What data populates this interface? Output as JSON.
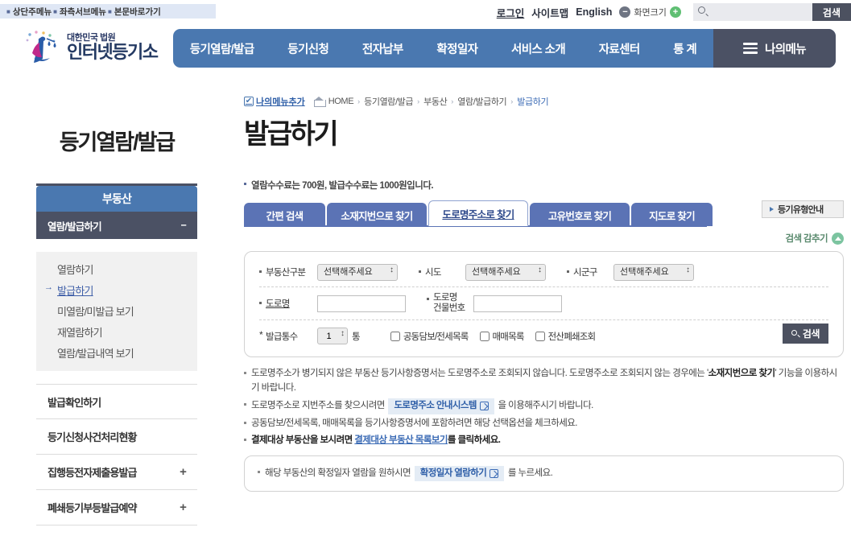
{
  "skipnav": {
    "items": [
      "상단주메뉴",
      "좌측서브메뉴",
      "본문바로가기"
    ]
  },
  "utility": {
    "login": "로그인",
    "sitemap": "사이트맵",
    "english": "English",
    "zoom_label": "화면크기",
    "zoom_out": "−",
    "zoom_in": "+",
    "search_placeholder": "",
    "search_value": "",
    "search_button": "검색"
  },
  "logo": {
    "line1": "대한민국 법원",
    "line2": "인터넷등기소"
  },
  "gnb": {
    "items": [
      "등기열람/발급",
      "등기신청",
      "전자납부",
      "확정일자",
      "서비스 소개",
      "자료센터",
      "통 계"
    ],
    "mymenu": "나의메뉴"
  },
  "breadcrumb": {
    "add_label": "나의메뉴추가",
    "check_glyph": "✔",
    "home": "HOME",
    "arrow": "›",
    "segments": [
      "등기열람/발급",
      "부동산",
      "열람/발급하기"
    ],
    "current": "발급하기"
  },
  "sidebar": {
    "title": "등기열람/발급",
    "category": "부동산",
    "group": {
      "label": "열람/발급하기",
      "toggle": "−"
    },
    "sub_items": [
      {
        "label": "열람하기",
        "active": false
      },
      {
        "label": "발급하기",
        "active": true
      },
      {
        "label": "미열람/미발급 보기",
        "active": false
      },
      {
        "label": "재열람하기",
        "active": false
      },
      {
        "label": "열람/발급내역 보기",
        "active": false
      }
    ],
    "rows": [
      {
        "label": "발급확인하기",
        "toggle": ""
      },
      {
        "label": "등기신청사건처리현황",
        "toggle": ""
      },
      {
        "label": "집행등전자제출용발급",
        "toggle": "+"
      },
      {
        "label": "폐쇄등기부등발급예약",
        "toggle": "+"
      }
    ]
  },
  "main": {
    "page_title": "발급하기",
    "fee_note": "열람수수료는 700원, 발급수수료는 1000원입니다.",
    "tabs": [
      {
        "label": "간편 검색",
        "active": false
      },
      {
        "label": "소재지번으로 찾기",
        "active": false
      },
      {
        "label": "도로명주소로 찾기",
        "active": true
      },
      {
        "label": "고유번호로 찾기",
        "active": false
      },
      {
        "label": "지도로 찾기",
        "active": false
      }
    ],
    "guide_button": "등기유형안내",
    "hide_search": "검색 감추기"
  },
  "form": {
    "property_type": {
      "label": "부동산구분",
      "value": "선택해주세요"
    },
    "sido": {
      "label": "시도",
      "value": "선택해주세요"
    },
    "sigungu": {
      "label": "시군구",
      "value": "선택해주세요"
    },
    "road_name": {
      "label": "도로명",
      "value": ""
    },
    "building_no": {
      "label_line1": "도로명",
      "label_line2": "건물번호",
      "value": ""
    },
    "copies": {
      "label": "발급통수",
      "value": "1",
      "unit": "통"
    },
    "checkboxes": [
      {
        "label": "공동담보/전세목록",
        "checked": false
      },
      {
        "label": "매매목록",
        "checked": false
      },
      {
        "label": "전산폐쇄조회",
        "checked": false
      }
    ],
    "search_button": "검색"
  },
  "notices": [
    {
      "parts": [
        {
          "t": "도로명주소가 병기되지 않은 부동산 등기사항증명서는 도로명주소로 조회되지 않습니다. 도로명주소로 조회되지 않는 경우에는 '",
          "k": "text"
        },
        {
          "t": "소재지번으로 찾기",
          "k": "bold"
        },
        {
          "t": "' 기능을 이용하시기 바랍니다.",
          "k": "text"
        }
      ]
    },
    {
      "parts": [
        {
          "t": "도로명주소로 지번주소를 찾으시려면",
          "k": "text"
        },
        {
          "t": "도로명주소 안내시스템",
          "k": "button"
        },
        {
          "t": "을 이용해주시기 바랍니다.",
          "k": "text"
        }
      ]
    },
    {
      "parts": [
        {
          "t": "공동담보/전세목록, 매매목록을 등기사항증명서에 포함하려면 해당 선택옵션을 체크하세요.",
          "k": "text"
        }
      ]
    },
    {
      "parts": [
        {
          "t": "결제대상 부동산을 보시려면 ",
          "k": "bold"
        },
        {
          "t": "결제대상 부동산 목록보기",
          "k": "link"
        },
        {
          "t": "를 클릭하세요.",
          "k": "bold"
        }
      ]
    }
  ],
  "subbox_notice": {
    "parts": [
      {
        "t": "해당 부동산의 확정일자 열람을 원하시면",
        "k": "text"
      },
      {
        "t": "확정일자 열람하기",
        "k": "button"
      },
      {
        "t": "를 누르세요.",
        "k": "text"
      }
    ]
  },
  "colors": {
    "gnb_blue": "#4a78b0",
    "gnb_dark": "#4b5164",
    "tab_blue": "#5b73b5",
    "link_blue": "#3b6bb5",
    "button_dark": "#4c5160",
    "green": "#7cc4a0"
  }
}
